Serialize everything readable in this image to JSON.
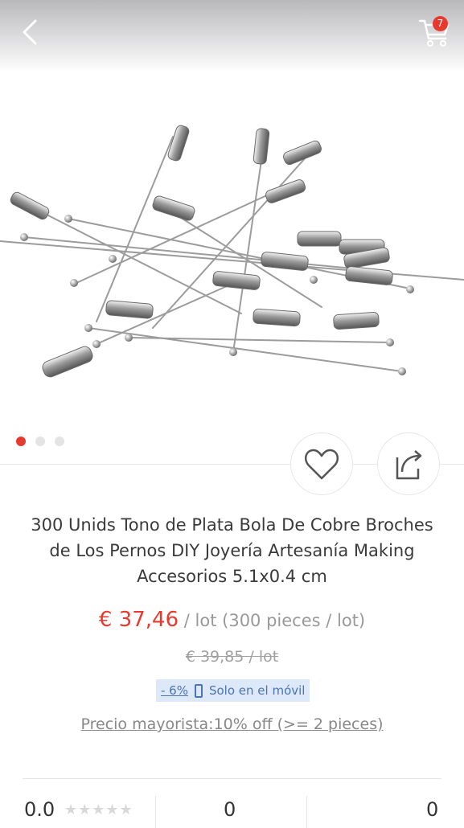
{
  "header": {
    "back_icon": "chevron-left-icon",
    "cart_icon": "shopping-cart-icon",
    "cart_count": "7"
  },
  "gallery": {
    "image_description": "silver-tone brooch pins with cylindrical clutch caps",
    "total_images": 3,
    "active_index": 0
  },
  "actions": {
    "favorite_icon": "heart-icon",
    "share_icon": "share-icon"
  },
  "product": {
    "title": "300 Unids Tono de Plata Bola De Cobre Broches de Los Pernos DIY Joyería Artesanía Making Accesorios 5.1x0.4 cm",
    "price": "€ 37,46",
    "price_unit": " / lot (300 pieces / lot)",
    "old_price": "€ 39,85  / lot",
    "discount": "- 6%",
    "mobile_only": "Solo en el móvil",
    "wholesale": "Precio mayorista:10% off (>= 2 pieces)"
  },
  "stats": {
    "rating": "0.0",
    "stars": "★★★★★",
    "orders": "0",
    "wishlist": "0"
  },
  "colors": {
    "accent": "#e8392f",
    "promo_bg": "#dde9f8",
    "promo_text": "#4a74b4"
  }
}
